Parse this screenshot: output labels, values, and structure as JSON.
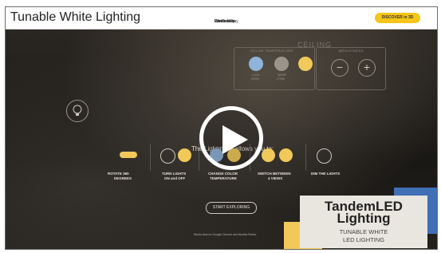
{
  "video": {
    "title": "Tunable White Lighting"
  },
  "nav": {
    "items": [
      "Our Tech",
      "Partnership",
      "Personalize",
      "Products",
      "Contact Us",
      "Where to buy"
    ],
    "cta": "DISCOVER in 3D"
  },
  "scene": {
    "ceiling_label": "CEILING",
    "color_temp_label": "COLOR TEMPERATURE",
    "brightness_label": "BRIGHTNESS",
    "cool_label": "COOL",
    "cool_value": "5000K",
    "warm_label": "WARM",
    "warm_value": "2700K",
    "minus": "−",
    "plus": "+",
    "intro": "The Lightmaxx allows you to:",
    "features": [
      {
        "label_1": "ROTATE 360",
        "label_2": "DEGREES"
      },
      {
        "label_1": "TURN LIGHTS",
        "label_2": "ON and OFF"
      },
      {
        "label_1": "CHANGE COLOR",
        "label_2": "TEMPERATURE"
      },
      {
        "label_1": "SWITCH BETWEEN",
        "label_2": "4 VIEWS"
      },
      {
        "label_1": "DIM THE LIGHTS",
        "label_2": ""
      }
    ],
    "explore": "START EXPLORING",
    "note": "Works best on Google Chrome and Mozilla Firefox"
  },
  "brand": {
    "line1": "TandemLED",
    "line2": "Lighting",
    "line3": "TUNABLE WHITE",
    "line4": "LED LIGHTING"
  },
  "colors": {
    "accent_yellow": "#f5c518",
    "cool_blue": "#8fb3d9",
    "warm_yellow": "#f0c95a",
    "brand_blue": "#3f6fb5"
  }
}
